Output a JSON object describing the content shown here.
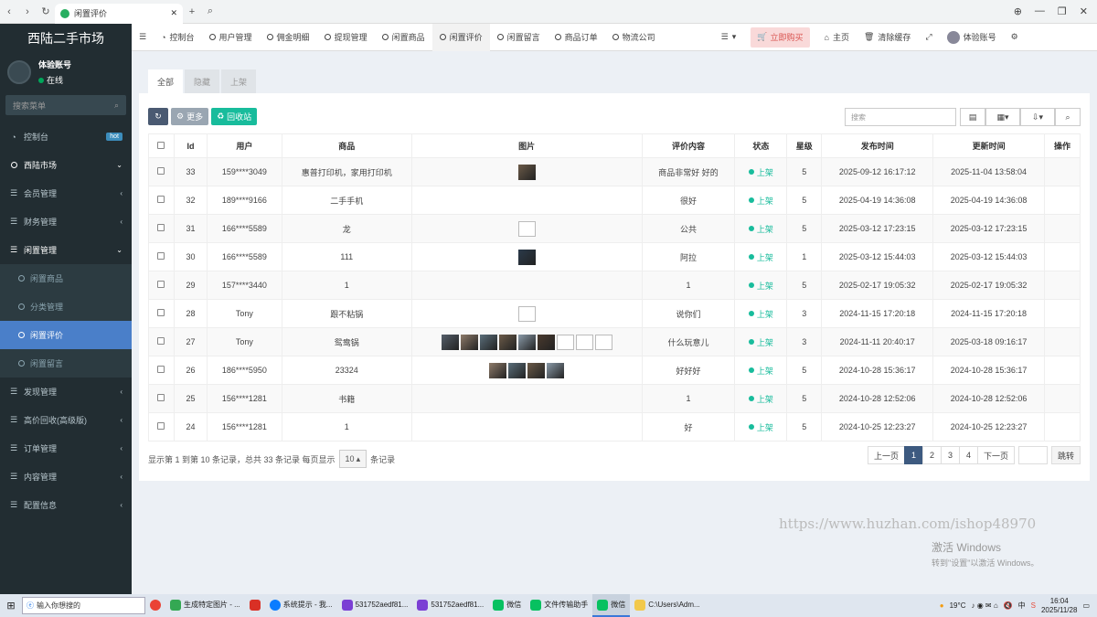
{
  "browser": {
    "tab_title": "闲置评价"
  },
  "sidebar": {
    "brand": "西陆二手市场",
    "user": {
      "name": "体验账号",
      "status": "在线"
    },
    "search_placeholder": "搜索菜单",
    "items": [
      {
        "label": "控制台",
        "icon": "dashboard-icon",
        "badge": "hot"
      },
      {
        "label": "西陆市场",
        "icon": "circle-icon",
        "open": true
      },
      {
        "label": "会员管理",
        "icon": "list-icon"
      },
      {
        "label": "财务管理",
        "icon": "list-icon"
      },
      {
        "label": "闲置管理",
        "icon": "list-icon",
        "open": true
      },
      {
        "label": "闲置商品",
        "sub": true
      },
      {
        "label": "分类管理",
        "sub": true
      },
      {
        "label": "闲置评价",
        "sub": true,
        "active": true
      },
      {
        "label": "闲置留言",
        "sub": true
      },
      {
        "label": "发现管理",
        "icon": "list-icon"
      },
      {
        "label": "高价回收(高级版)",
        "icon": "list-icon"
      },
      {
        "label": "订单管理",
        "icon": "list-icon"
      },
      {
        "label": "内容管理",
        "icon": "list-icon"
      },
      {
        "label": "配置信息",
        "icon": "list-icon"
      }
    ]
  },
  "topnav": {
    "items": [
      "控制台",
      "用户管理",
      "佣金明细",
      "提现管理",
      "闲置商品",
      "闲置评价",
      "闲置留言",
      "商品订单",
      "物流公司"
    ],
    "active_index": 5,
    "buy_now": "立即购买",
    "home": "主页",
    "clear_cache": "清除缓存",
    "account": "体验账号"
  },
  "subtabs": [
    "全部",
    "隐藏",
    "上架"
  ],
  "toolbar": {
    "more": "更多",
    "recycle": "回收站",
    "search_placeholder": "搜索"
  },
  "table": {
    "headers": [
      "Id",
      "用户",
      "商品",
      "图片",
      "评价内容",
      "状态",
      "星级",
      "发布时间",
      "更新时间",
      "操作"
    ],
    "rows": [
      {
        "id": "33",
        "user": "159****3049",
        "product": "惠普打印机，家用打印机",
        "images": [
          "photo"
        ],
        "content": "商品非常好 好的",
        "status": "上架",
        "stars": "5",
        "created": "2025-09-12 16:17:12",
        "updated": "2025-11-04 13:58:04"
      },
      {
        "id": "32",
        "user": "189****9166",
        "product": "二手手机",
        "images": [],
        "content": "很好",
        "status": "上架",
        "stars": "5",
        "created": "2025-04-19 14:36:08",
        "updated": "2025-04-19 14:36:08"
      },
      {
        "id": "31",
        "user": "166****5589",
        "product": "龙",
        "images": [
          "broken"
        ],
        "content": "公共",
        "status": "上架",
        "stars": "5",
        "created": "2025-03-12 17:23:15",
        "updated": "2025-03-12 17:23:15"
      },
      {
        "id": "30",
        "user": "166****5589",
        "product": "111",
        "images": [
          "photo"
        ],
        "content": "阿拉",
        "status": "上架",
        "stars": "1",
        "created": "2025-03-12 15:44:03",
        "updated": "2025-03-12 15:44:03"
      },
      {
        "id": "29",
        "user": "157****3440",
        "product": "1",
        "images": [],
        "content": "1",
        "status": "上架",
        "stars": "5",
        "created": "2025-02-17 19:05:32",
        "updated": "2025-02-17 19:05:32"
      },
      {
        "id": "28",
        "user": "Tony",
        "product": "跟不粘锅",
        "images": [
          "broken"
        ],
        "content": "说你们",
        "status": "上架",
        "stars": "3",
        "created": "2024-11-15 17:20:18",
        "updated": "2024-11-15 17:20:18"
      },
      {
        "id": "27",
        "user": "Tony",
        "product": "鸳鸯锅",
        "images": [
          "photo",
          "photo",
          "photo",
          "photo",
          "photo",
          "photo",
          "broken",
          "broken",
          "broken"
        ],
        "content": "什么玩意儿",
        "status": "上架",
        "stars": "3",
        "created": "2024-11-11 20:40:17",
        "updated": "2025-03-18 09:16:17"
      },
      {
        "id": "26",
        "user": "186****5950",
        "product": "23324",
        "images": [
          "photo",
          "photo",
          "photo",
          "photo"
        ],
        "content": "好好好",
        "status": "上架",
        "stars": "5",
        "created": "2024-10-28 15:36:17",
        "updated": "2024-10-28 15:36:17"
      },
      {
        "id": "25",
        "user": "156****1281",
        "product": "书籍",
        "images": [],
        "content": "1",
        "status": "上架",
        "stars": "5",
        "created": "2024-10-28 12:52:06",
        "updated": "2024-10-28 12:52:06"
      },
      {
        "id": "24",
        "user": "156****1281",
        "product": "1",
        "images": [],
        "content": "好",
        "status": "上架",
        "stars": "5",
        "created": "2024-10-25 12:23:27",
        "updated": "2024-10-25 12:23:27"
      }
    ]
  },
  "footer": {
    "pre": "显示第 1 到第 10 条记录，总共 33 条记录 每页显示",
    "page_size": "10",
    "post": "条记录"
  },
  "pager": {
    "prev": "上一页",
    "pages": [
      "1",
      "2",
      "3",
      "4"
    ],
    "current": "1",
    "next": "下一页",
    "jump": "跳转"
  },
  "watermark": "https://www.huzhan.com/ishop48970",
  "activation": {
    "line1": "激活 Windows",
    "line2": "转到\"设置\"以激活 Windows。"
  },
  "taskbar": {
    "search_placeholder": "输入你想搜的",
    "apps": [
      "生成特定图片 - ...",
      "系统提示 - 我...",
      "531752aedf81...",
      "531752aedf81...",
      "微信",
      "文件传输助手",
      "微信",
      "C:\\Users\\Adm..."
    ],
    "active_app_index": 6,
    "weather": "19°C",
    "ime": "中",
    "time": "16:04",
    "date": "2025/11/28"
  }
}
